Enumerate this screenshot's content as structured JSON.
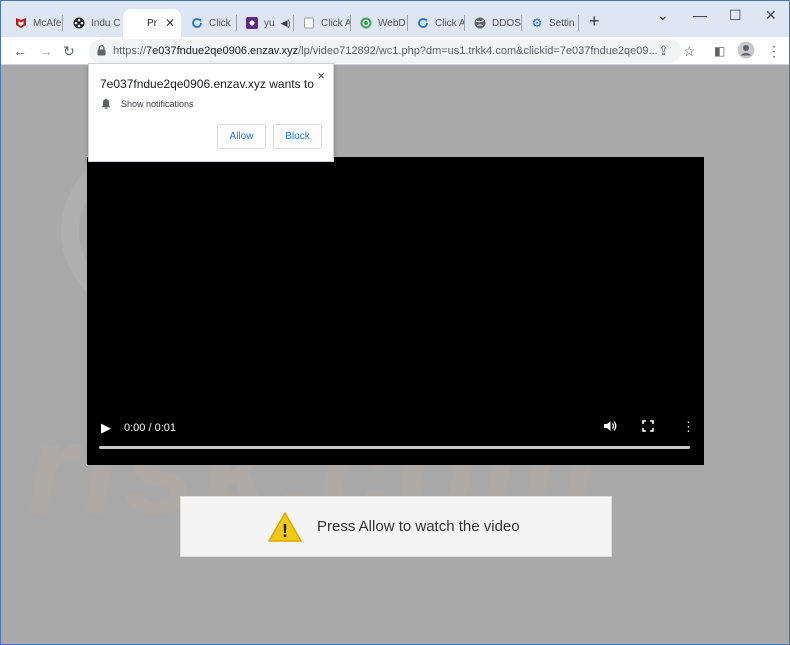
{
  "tabs": [
    {
      "label": "McAfe",
      "icon": "mcafee-icon",
      "color": "#c01818"
    },
    {
      "label": "Indu C",
      "icon": "film-reel-icon",
      "color": "#202124"
    },
    {
      "label": "Pr",
      "icon": "blank-icon",
      "color": "#ffffff",
      "active": true
    },
    {
      "label": "Click",
      "icon": "refresh-blue-icon",
      "color": "#1a73e8"
    },
    {
      "label": "yu",
      "icon": "media-icon",
      "color": "#6a1b9a"
    },
    {
      "label": "Click A",
      "icon": "page-icon",
      "color": "#9aa0a6"
    },
    {
      "label": "WebD",
      "icon": "green-circle-icon",
      "color": "#34a853"
    },
    {
      "label": "Click A",
      "icon": "refresh-blue-icon",
      "color": "#1a73e8"
    },
    {
      "label": "DDOS",
      "icon": "globe-icon",
      "color": "#5f6368"
    },
    {
      "label": "Settin",
      "icon": "gear-icon",
      "color": "#1a73e8"
    }
  ],
  "address_bar": {
    "scheme": "https://",
    "host": "7e037fndue2qe0906.enzav.xyz",
    "path": "/lp/video712892/wc1.php?dm=us1.trkk4.com&clickid=7e037fndue2qe09..."
  },
  "permission_popup": {
    "title": "7e037fndue2qe0906.enzav.xyz wants to",
    "item": "Show notifications",
    "allow_label": "Allow",
    "block_label": "Block",
    "close_glyph": "×"
  },
  "video": {
    "time": "0:00 / 0:01"
  },
  "banner": {
    "text": "Press Allow to watch the video",
    "warn_glyph": "!"
  },
  "watermark": {
    "text": "risk.com"
  },
  "colors": {
    "page_bg": "#a9a9a9",
    "link_blue": "#1a73e8",
    "warning_yellow": "#f2c81b"
  }
}
